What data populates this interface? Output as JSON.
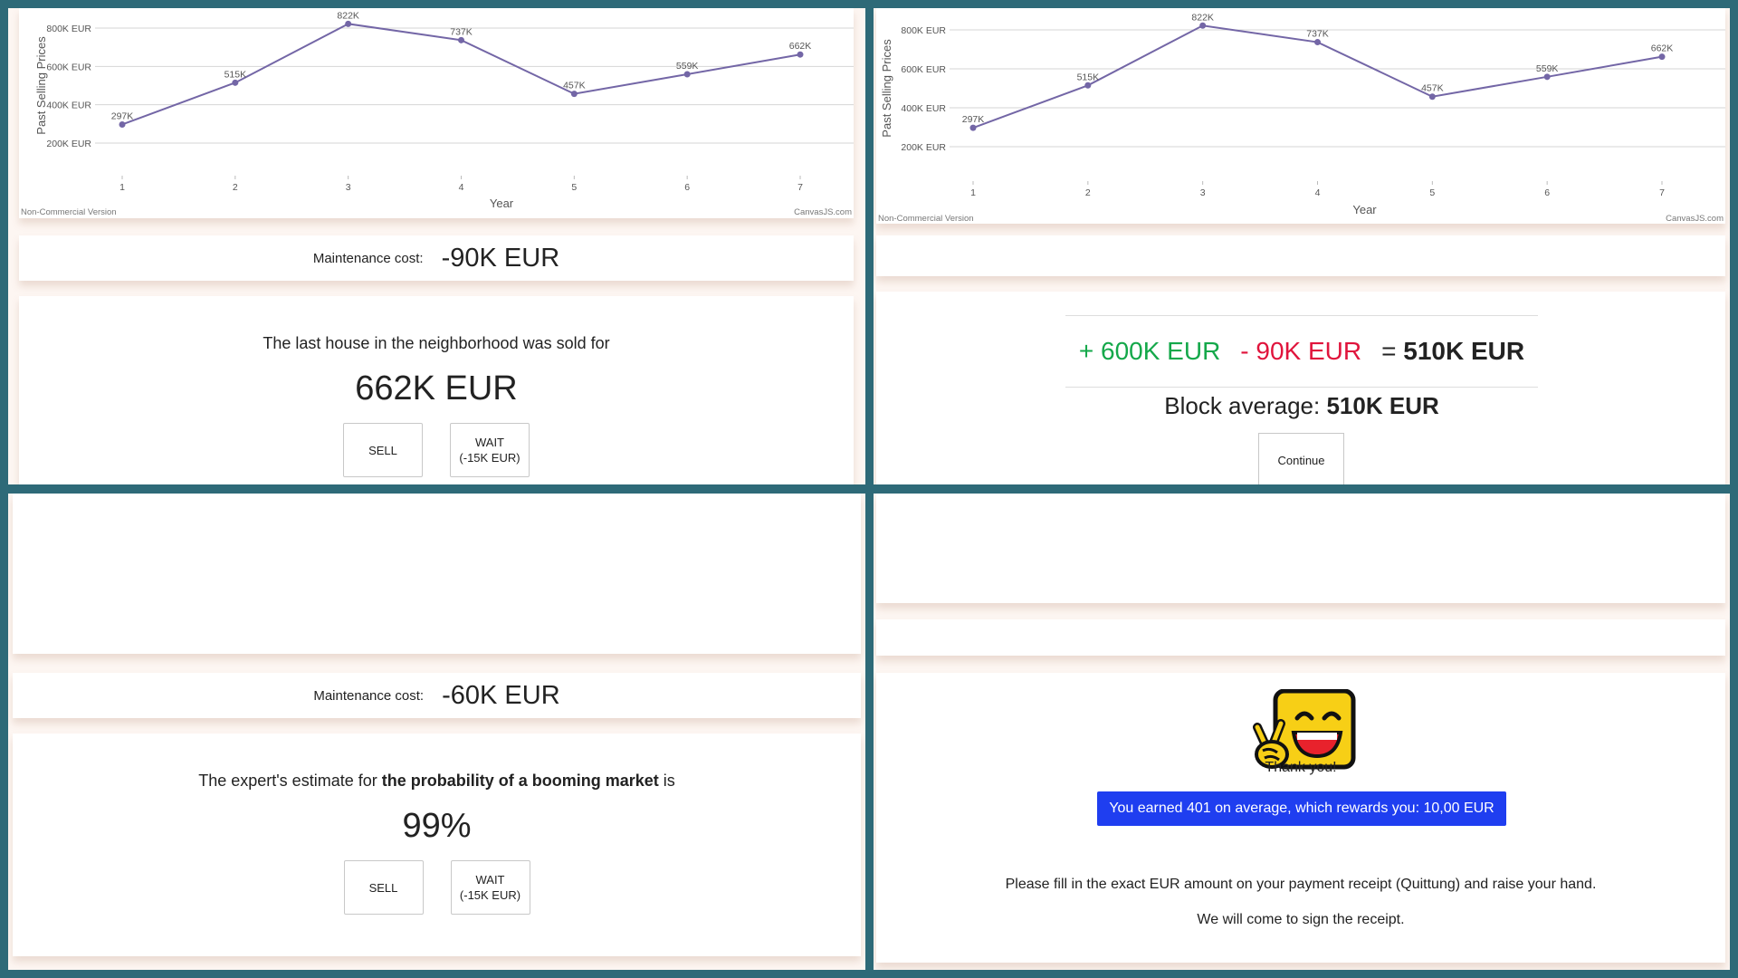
{
  "colors": {
    "background": "#2e6a78",
    "line": "#7366a6",
    "positive": "#14a84a",
    "negative": "#e0143c",
    "reward_bg": "#1f3ef0"
  },
  "chart_data": [
    {
      "type": "line",
      "x": [
        1,
        2,
        3,
        4,
        5,
        6,
        7
      ],
      "values": [
        297,
        515,
        822,
        737,
        457,
        559,
        662
      ],
      "data_labels": [
        "297K",
        "515K",
        "822K",
        "737K",
        "457K",
        "559K",
        "662K"
      ],
      "yticks": [
        "200K EUR",
        "400K EUR",
        "600K EUR",
        "800K EUR"
      ],
      "ylim": [
        0,
        840
      ],
      "xlabel": "Year",
      "ylabel": "Past Selling Prices",
      "watermark_left": "Non-Commercial Version",
      "watermark_right": "CanvasJS.com",
      "grid": true
    },
    {
      "type": "line",
      "x": [
        1,
        2,
        3,
        4,
        5,
        6,
        7
      ],
      "values": [
        297,
        515,
        822,
        737,
        457,
        559,
        662
      ],
      "data_labels": [
        "297K",
        "515K",
        "822K",
        "737K",
        "457K",
        "559K",
        "662K"
      ],
      "yticks": [
        "200K EUR",
        "400K EUR",
        "600K EUR",
        "800K EUR"
      ],
      "ylim": [
        0,
        840
      ],
      "xlabel": "Year",
      "ylabel": "Past Selling Prices",
      "watermark_left": "Non-Commercial Version",
      "watermark_right": "CanvasJS.com",
      "grid": true
    }
  ],
  "panel1": {
    "maintenance_label": "Maintenance cost:",
    "maintenance_value": "-90K EUR",
    "prompt": "The last house in the neighborhood was sold for",
    "value": "662K EUR",
    "sell": "SELL",
    "wait_line1": "WAIT",
    "wait_line2": "(-15K EUR)"
  },
  "panel2": {
    "plus": "+ 600K EUR",
    "minus": "- 90K EUR",
    "equals": "=",
    "result": "510K EUR",
    "block_avg_label": "Block average:",
    "block_avg_value": "510K EUR",
    "continue": "Continue"
  },
  "panel3": {
    "maintenance_label": "Maintenance cost:",
    "maintenance_value": "-60K EUR",
    "prompt_pre": "The expert's estimate for",
    "prompt_bold": "the probability of a booming market",
    "prompt_post": "is",
    "value": "99%",
    "sell": "SELL",
    "wait_line1": "WAIT",
    "wait_line2": "(-15K EUR)"
  },
  "panel4": {
    "icon": "victory-smiley-icon",
    "thank_you": "Thank you!",
    "reward": "You earned 401 on average, which rewards you: 10,00 EUR",
    "instruction1": "Please fill in the exact EUR amount on your payment receipt (Quittung) and raise your hand.",
    "instruction2": "We will come to sign the receipt."
  }
}
